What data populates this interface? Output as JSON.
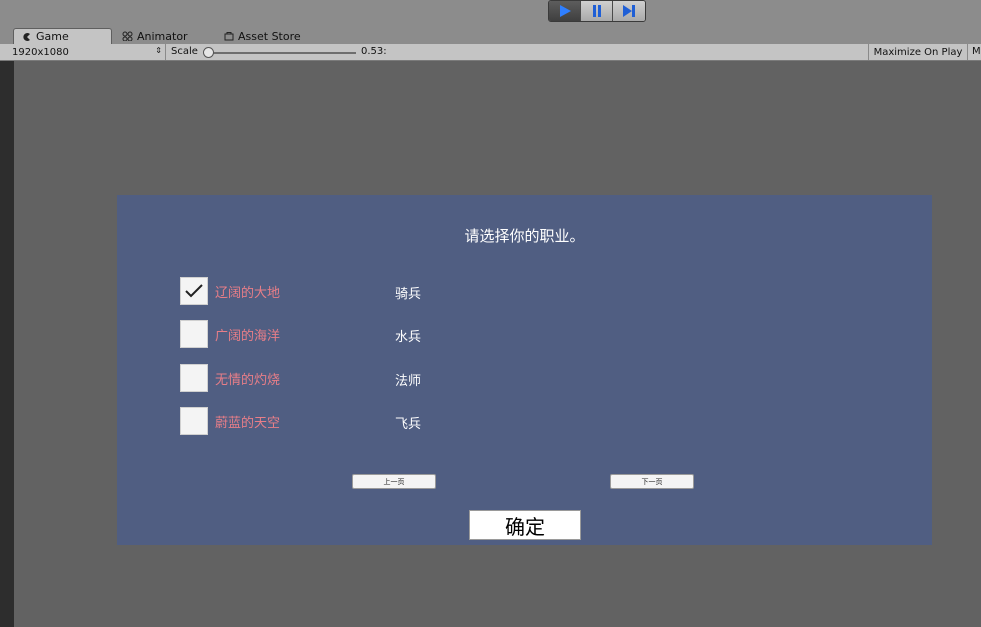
{
  "toolbar": {
    "play_icon": "play-icon",
    "pause_icon": "pause-icon",
    "step_icon": "step-icon",
    "accent": "#2f7fff"
  },
  "tabs": [
    {
      "label": "Game",
      "icon": "game-icon"
    },
    {
      "label": "Animator",
      "icon": "animator-icon"
    },
    {
      "label": "Asset Store",
      "icon": "asset-store-icon"
    }
  ],
  "gamebar": {
    "resolution": "1920x1080",
    "scale_label": "Scale",
    "scale_value": "0.53:",
    "maximize_label": "Maximize On Play",
    "mute_label": "M"
  },
  "game": {
    "prompt": "请选择你的职业。",
    "options": [
      {
        "label": "辽阔的大地",
        "class": "骑兵",
        "checked": true
      },
      {
        "label": "广阔的海洋",
        "class": "水兵",
        "checked": false
      },
      {
        "label": "无情的灼烧",
        "class": "法师",
        "checked": false
      },
      {
        "label": "蔚蓝的天空",
        "class": "飞兵",
        "checked": false
      }
    ],
    "prev_label": "上一页",
    "next_label": "下一页",
    "confirm_label": "确定",
    "panel_color": "#505e82",
    "option_color": "#e87e88"
  }
}
